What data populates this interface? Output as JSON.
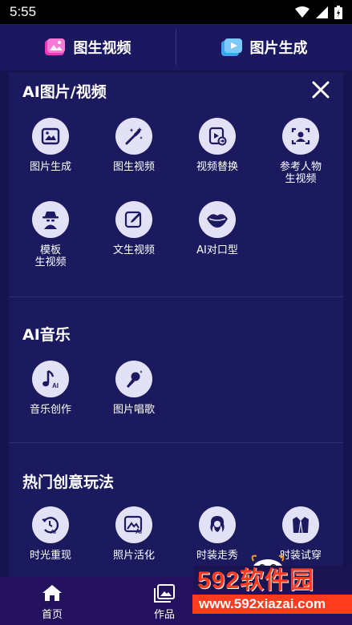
{
  "status_bar": {
    "time": "5:55"
  },
  "top_tabs": [
    {
      "label": "图生视频",
      "icon": "image-video-icon"
    },
    {
      "label": "图片生成",
      "icon": "image-generate-icon"
    }
  ],
  "sections": [
    {
      "title": "AI图片/视频",
      "tools": [
        {
          "label": "图片生成",
          "icon": "image-icon"
        },
        {
          "label": "图生视频",
          "icon": "magic-wand-icon"
        },
        {
          "label": "视频替换",
          "icon": "video-swap-icon"
        },
        {
          "label": "参考人物\n生视频",
          "icon": "person-frame-icon"
        },
        {
          "label": "模板\n生视频",
          "icon": "spy-template-icon"
        },
        {
          "label": "文生视频",
          "icon": "edit-text-icon"
        },
        {
          "label": "AI对口型",
          "icon": "lips-icon"
        }
      ]
    },
    {
      "title": "AI音乐",
      "tools": [
        {
          "label": "音乐创作",
          "icon": "music-note-ai-icon"
        },
        {
          "label": "图片唱歌",
          "icon": "microphone-icon"
        }
      ]
    },
    {
      "title": "热门创意玩法",
      "tools": [
        {
          "label": "时光重现",
          "icon": "time-rewind-ai-icon"
        },
        {
          "label": "照片活化",
          "icon": "photo-ai-icon"
        },
        {
          "label": "时装走秀",
          "icon": "woman-hair-icon"
        },
        {
          "label": "时装试穿",
          "icon": "suit-icon"
        }
      ]
    }
  ],
  "bottom_nav": [
    {
      "label": "首页",
      "icon": "home-icon"
    },
    {
      "label": "作品",
      "icon": "gallery-icon"
    }
  ],
  "watermark": {
    "brand": "592软件园",
    "url": "www.592xiazai.com"
  },
  "colors": {
    "background": "#16134f",
    "panel": "#1b1a5e",
    "icon_circle": "#e3e1f6",
    "icon_glyph": "#1d1a62",
    "bottom_nav": "#24125f"
  }
}
